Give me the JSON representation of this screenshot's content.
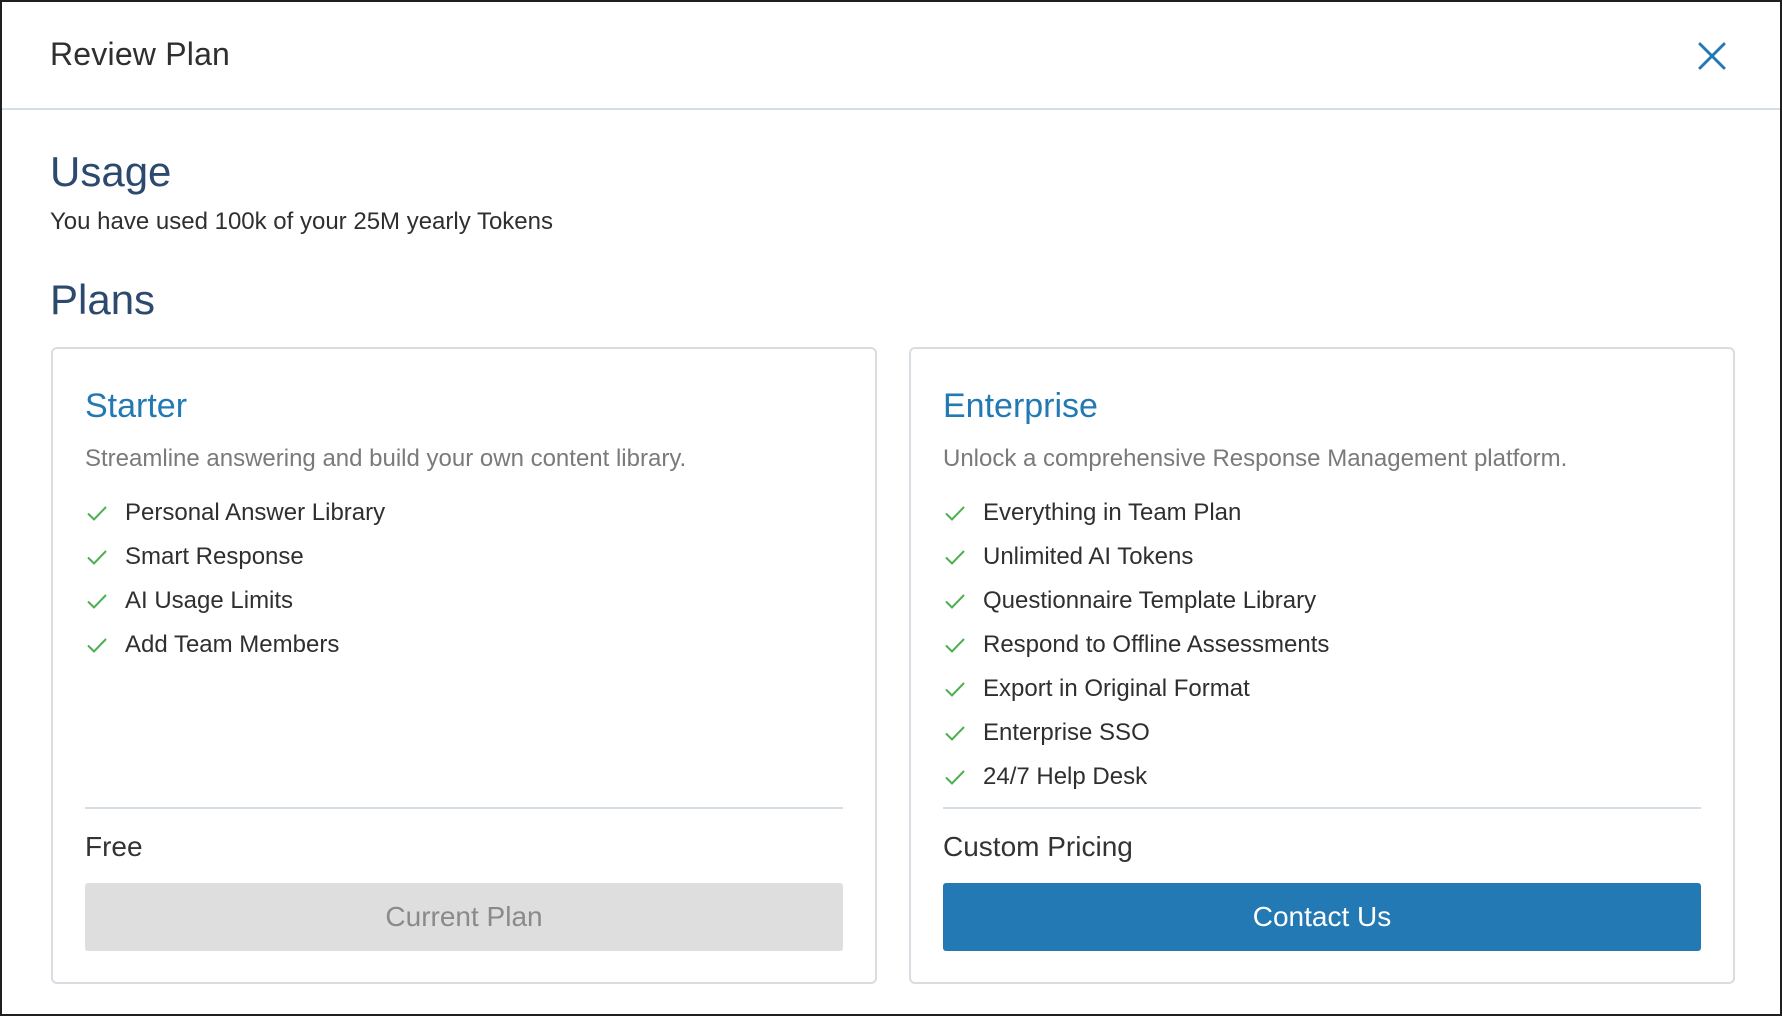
{
  "modal": {
    "title": "Review Plan",
    "close_icon": "close-icon"
  },
  "usage": {
    "heading": "Usage",
    "text": "You have used 100k of your 25M yearly Tokens"
  },
  "plans": {
    "heading": "Plans",
    "starter": {
      "name": "Starter",
      "description": "Streamline answering and build your own content library.",
      "features": [
        "Personal Answer Library",
        "Smart Response",
        "AI Usage Limits",
        "Add Team Members"
      ],
      "price": "Free",
      "button_label": "Current Plan"
    },
    "enterprise": {
      "name": "Enterprise",
      "description": "Unlock a comprehensive Response Management platform.",
      "features": [
        "Everything in Team Plan",
        "Unlimited AI Tokens",
        "Questionnaire Template Library",
        "Respond to Offline Assessments",
        "Export in Original Format",
        "Enterprise SSO",
        "24/7 Help Desk"
      ],
      "price": "Custom Pricing",
      "button_label": "Contact Us"
    }
  },
  "colors": {
    "accent": "#2379b3",
    "heading": "#2c4a6e",
    "check": "#4caf50",
    "disabled_button": "#dedede"
  }
}
